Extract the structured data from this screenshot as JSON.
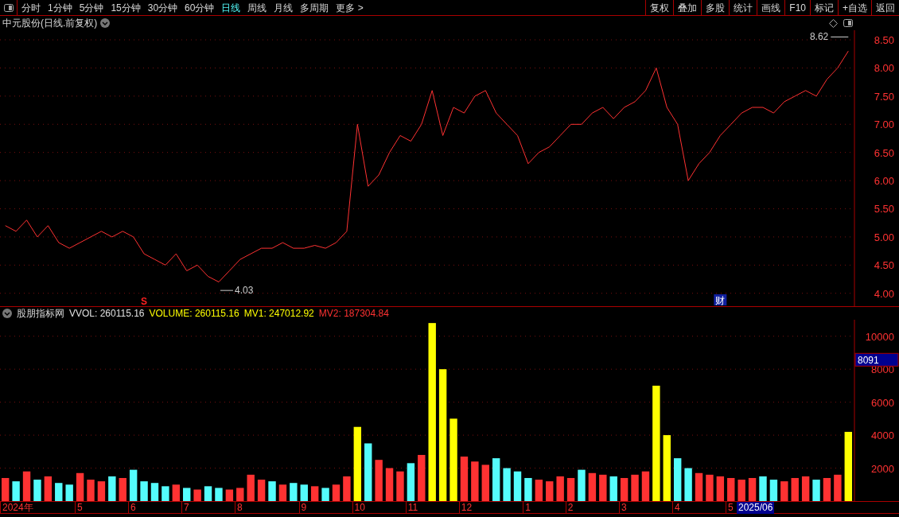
{
  "toolbar": {
    "periods": [
      {
        "label": "分时",
        "selected": false
      },
      {
        "label": "1分钟",
        "selected": false
      },
      {
        "label": "5分钟",
        "selected": false
      },
      {
        "label": "15分钟",
        "selected": false
      },
      {
        "label": "30分钟",
        "selected": false
      },
      {
        "label": "60分钟",
        "selected": false
      },
      {
        "label": "日线",
        "selected": true
      },
      {
        "label": "周线",
        "selected": false
      },
      {
        "label": "月线",
        "selected": false
      },
      {
        "label": "多周期",
        "selected": false
      },
      {
        "label": "更多 >",
        "selected": false
      }
    ],
    "actions": [
      "复权",
      "叠加",
      "多股",
      "统计",
      "画线",
      "F10",
      "标记",
      "+自选",
      "返回"
    ]
  },
  "price_panel": {
    "title": "中元股份(日线.前复权)",
    "markers": [
      {
        "label": "S",
        "kind": "signal"
      },
      {
        "label": "财",
        "kind": "finance"
      }
    ],
    "chart_data": {
      "type": "line",
      "grid": true,
      "ylim": [
        3.77,
        8.67
      ],
      "yticks": [
        {
          "value": 4,
          "label": "4.00"
        },
        {
          "value": 4.5,
          "label": "4.50"
        },
        {
          "value": 5,
          "label": "5.00"
        },
        {
          "value": 5.5,
          "label": "5.50"
        },
        {
          "value": 6,
          "label": "6.00"
        },
        {
          "value": 6.5,
          "label": "6.50"
        },
        {
          "value": 7,
          "label": "7.00"
        },
        {
          "value": 7.5,
          "label": "7.50"
        },
        {
          "value": 8,
          "label": "8.00"
        },
        {
          "value": 8.5,
          "label": "8.50"
        }
      ],
      "series": [
        {
          "color": "#ff3232",
          "values": [
            5.2,
            5.1,
            5.3,
            5.0,
            5.2,
            4.9,
            4.8,
            4.9,
            5.0,
            5.1,
            5.0,
            5.1,
            5.0,
            4.7,
            4.6,
            4.5,
            4.7,
            4.4,
            4.5,
            4.3,
            4.2,
            4.4,
            4.6,
            4.7,
            4.8,
            4.8,
            4.9,
            4.8,
            4.8,
            4.85,
            4.8,
            4.9,
            5.1,
            7.0,
            5.9,
            6.1,
            6.5,
            6.8,
            6.7,
            7.0,
            7.6,
            6.8,
            7.3,
            7.2,
            7.5,
            7.6,
            7.2,
            7.0,
            6.8,
            6.3,
            6.5,
            6.6,
            6.8,
            7.0,
            7.0,
            7.2,
            7.3,
            7.1,
            7.3,
            7.4,
            7.6,
            8.0,
            7.3,
            7.0,
            6.0,
            6.3,
            6.5,
            6.8,
            7.0,
            7.2,
            7.3,
            7.3,
            7.2,
            7.4,
            7.5,
            7.6,
            7.5,
            7.8,
            8.0,
            8.3
          ]
        }
      ],
      "annotations": [
        "8.62",
        "4.03"
      ]
    }
  },
  "volume_panel": {
    "name": "股朋指标网",
    "readouts": [
      {
        "text": "VVOL: 260115.16",
        "color": "#e0e0e0"
      },
      {
        "text": "VOLUME: 260115.16",
        "color": "#ffff00"
      },
      {
        "text": "MV1: 247012.92",
        "color": "#ffff00"
      },
      {
        "text": "MV2: 187304.84",
        "color": "#ff3232"
      }
    ],
    "cursor_value": "8091",
    "date_labels": [
      "2024年",
      "5",
      "6",
      "7",
      "8",
      "9",
      "10",
      "11",
      "12",
      "1",
      "2",
      "3",
      "4",
      "5"
    ],
    "cursor_date": "2025/06",
    "chart_data": {
      "type": "bar",
      "grid": true,
      "ylim": [
        0,
        11000
      ],
      "yticks": [
        {
          "value": 2000,
          "label": "2000"
        },
        {
          "value": 4000,
          "label": "4000"
        },
        {
          "value": 6000,
          "label": "6000"
        },
        {
          "value": 8000,
          "label": "8000"
        },
        {
          "value": 10000,
          "label": "10000"
        }
      ],
      "series": [
        {
          "color": "#ff3232",
          "values": [
            1400,
            null,
            1800,
            null,
            1500,
            null,
            null,
            1700,
            1300,
            1200,
            null,
            1400,
            null,
            null,
            null,
            null,
            1000,
            null,
            700,
            null,
            null,
            700,
            800,
            1600,
            1300,
            null,
            1000,
            null,
            null,
            900,
            null,
            1000,
            1500,
            null,
            null,
            2500,
            2000,
            1800,
            null,
            2800,
            null,
            null,
            null,
            2700,
            2400,
            2200,
            null,
            null,
            null,
            null,
            1300,
            1200,
            1500,
            1400,
            null,
            1700,
            1600,
            null,
            1400,
            1600,
            1800,
            null,
            null,
            null,
            null,
            1700,
            1600,
            1500,
            1400,
            1300,
            1400,
            null,
            null,
            1200,
            1400,
            1500,
            null,
            1400,
            1600,
            null
          ]
        },
        {
          "color": "#54fcfc",
          "values": [
            null,
            1200,
            null,
            1300,
            null,
            1100,
            1000,
            null,
            null,
            null,
            1500,
            null,
            1900,
            1200,
            1100,
            900,
            null,
            800,
            null,
            900,
            800,
            null,
            null,
            null,
            null,
            1200,
            null,
            1100,
            1000,
            null,
            800,
            null,
            null,
            null,
            3500,
            null,
            null,
            null,
            2300,
            null,
            null,
            null,
            null,
            null,
            null,
            null,
            2600,
            2000,
            1800,
            1400,
            null,
            null,
            null,
            null,
            1900,
            null,
            null,
            1500,
            null,
            null,
            null,
            null,
            null,
            2600,
            2000,
            null,
            null,
            null,
            null,
            null,
            null,
            1500,
            1300,
            null,
            null,
            null,
            1300,
            null,
            null,
            null
          ]
        },
        {
          "color": "#ffff00",
          "values": [
            null,
            null,
            null,
            null,
            null,
            null,
            null,
            null,
            null,
            null,
            null,
            null,
            null,
            null,
            null,
            null,
            null,
            null,
            null,
            null,
            null,
            null,
            null,
            null,
            null,
            null,
            null,
            null,
            null,
            null,
            null,
            null,
            null,
            4500,
            null,
            null,
            null,
            null,
            null,
            null,
            10800,
            8000,
            5000,
            null,
            null,
            null,
            null,
            null,
            null,
            null,
            null,
            null,
            null,
            null,
            null,
            null,
            null,
            null,
            null,
            null,
            null,
            7000,
            4000,
            null,
            null,
            null,
            null,
            null,
            null,
            null,
            null,
            null,
            null,
            null,
            null,
            null,
            null,
            null,
            null,
            4200
          ]
        }
      ]
    }
  }
}
